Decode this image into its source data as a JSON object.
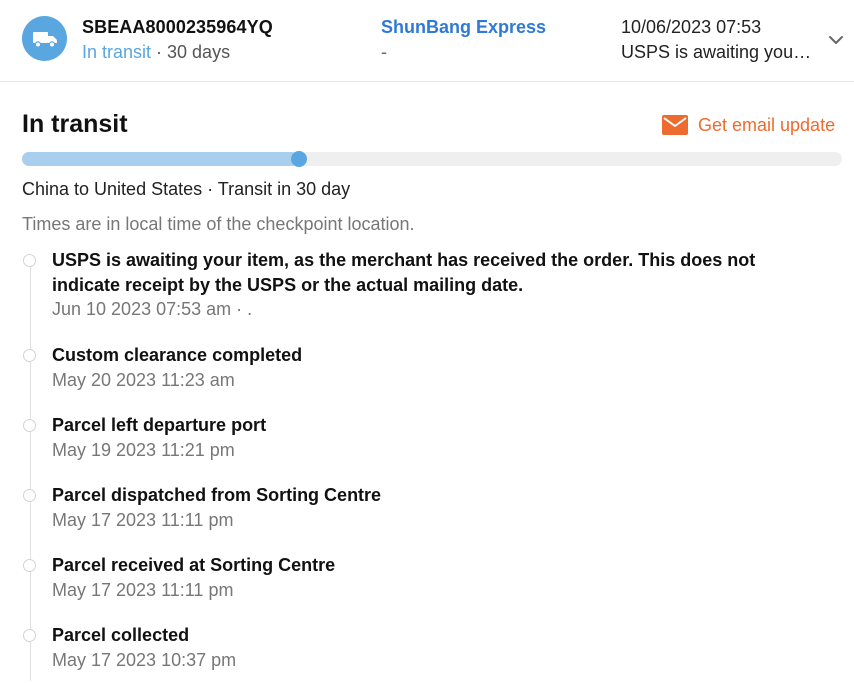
{
  "header": {
    "tracking_number": "SBEAA8000235964YQ",
    "status": "In transit",
    "duration": " · 30 days",
    "carrier": "ShunBang Express",
    "carrier_sub": "-",
    "latest_time": "10/06/2023 07:53",
    "latest_event": "USPS is awaiting your item, as the merchant has received the order. This does not indicate receipt by the USPS or the actual mailing date.",
    "icons": {
      "avatar": "truck-icon",
      "expand": "chevron-down-icon"
    }
  },
  "summary": {
    "title": "In transit",
    "email_label": "Get email update",
    "email_icon": "envelope-icon",
    "progress_fraction": 0.338,
    "route": "China to United States · Transit in 30 day",
    "timezone_note": "Times are in local time of the checkpoint location."
  },
  "events": [
    {
      "title": "USPS is awaiting your item, as the merchant has received the order. This does not indicate receipt by the USPS or the actual mailing date.",
      "time": "Jun 10 2023 07:53 am · ."
    },
    {
      "title": "Custom clearance completed",
      "time": "May 20 2023 11:23 am"
    },
    {
      "title": "Parcel left departure port",
      "time": "May 19 2023 11:21 pm"
    },
    {
      "title": "Parcel dispatched from Sorting Centre",
      "time": "May 17 2023 11:11 pm"
    },
    {
      "title": "Parcel received at Sorting Centre",
      "time": "May 17 2023 11:11 pm"
    },
    {
      "title": "Parcel collected",
      "time": "May 17 2023 10:37 pm"
    }
  ],
  "colors": {
    "accent": "#5aa6e0",
    "carrier": "#2f7ad6",
    "email": "#ee6b2f",
    "progress_fill": "#a9cfee",
    "progress_track": "#efefef"
  }
}
